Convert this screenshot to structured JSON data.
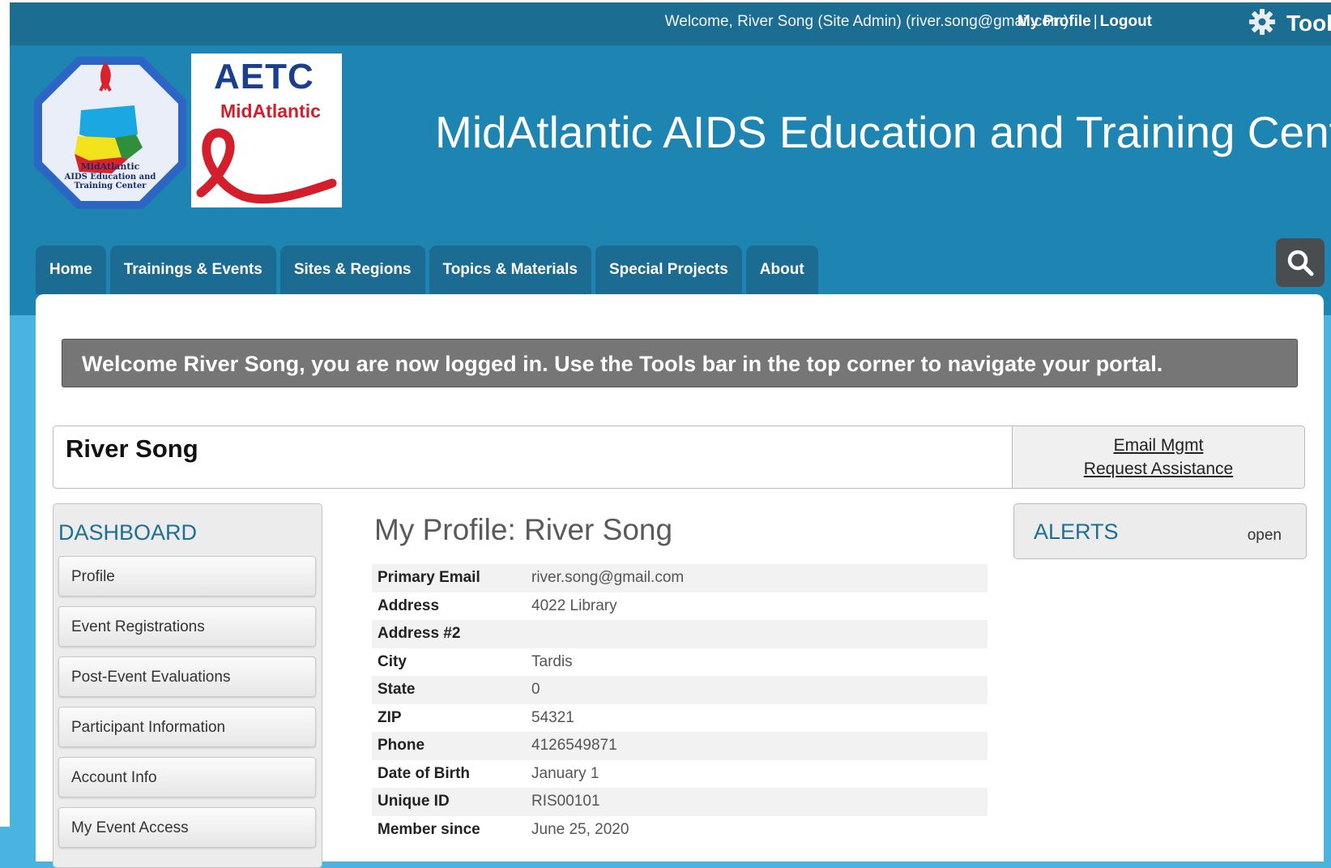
{
  "topbar": {
    "welcome": "Welcome, River Song (Site Admin) (river.song@gmail.com)",
    "my_profile": "My Profile",
    "separator": "|",
    "logout": "Logout",
    "tools_label": "Tools",
    "tools_icon": "gear-icon"
  },
  "header": {
    "logo1_label": "MidAtlantic AIDS Education and Training Center",
    "logo2_title": "AETC",
    "logo2_subtitle": "MidAtlantic",
    "site_title": "MidAtlantic AIDS Education and Training Center"
  },
  "nav": {
    "tabs": [
      {
        "label": "Home"
      },
      {
        "label": "Trainings & Events"
      },
      {
        "label": "Sites & Regions"
      },
      {
        "label": "Topics & Materials"
      },
      {
        "label": "Special Projects"
      },
      {
        "label": "About"
      }
    ],
    "search_icon": "search-icon"
  },
  "welcome_message": "Welcome River Song, you are now logged in. Use the Tools bar in the top corner to navigate your portal.",
  "user": {
    "name": "River Song",
    "email_mgmt": "Email Mgmt",
    "request_assistance": "Request Assistance"
  },
  "dashboard": {
    "title": "DASHBOARD",
    "items": [
      {
        "label": "Profile"
      },
      {
        "label": "Event Registrations"
      },
      {
        "label": "Post-Event Evaluations"
      },
      {
        "label": "Participant Information"
      },
      {
        "label": "Account Info"
      },
      {
        "label": "My Event Access"
      }
    ]
  },
  "profile": {
    "title": "My Profile: River Song",
    "rows": [
      {
        "key": "Primary Email",
        "value": "river.song@gmail.com"
      },
      {
        "key": "Address",
        "value": "4022 Library"
      },
      {
        "key": "Address #2",
        "value": ""
      },
      {
        "key": "City",
        "value": "Tardis"
      },
      {
        "key": "State",
        "value": "0"
      },
      {
        "key": "ZIP",
        "value": "54321"
      },
      {
        "key": "Phone",
        "value": "4126549871"
      },
      {
        "key": "Date of Birth",
        "value": "January 1"
      },
      {
        "key": "Unique ID",
        "value": "RIS00101"
      },
      {
        "key": "Member since",
        "value": "June 25, 2020"
      }
    ]
  },
  "alerts": {
    "title": "ALERTS",
    "toggle": "open"
  },
  "colors": {
    "topbar": "#1c6d92",
    "header": "#1e84b1",
    "nav_tab": "#1b6b92",
    "accent_text": "#1e6f95",
    "message_bg": "#767676",
    "page_bg": "#4ab3e0"
  }
}
